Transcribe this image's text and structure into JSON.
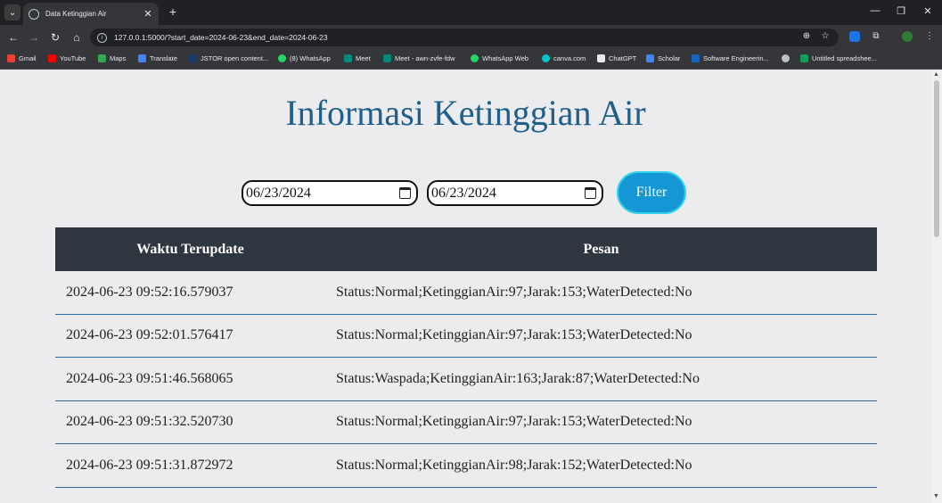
{
  "browser": {
    "tab_title": "Data Ketinggian Air",
    "url": "127.0.0.1:5000/?start_date=2024-06-23&end_date=2024-06-23",
    "bookmarks": [
      {
        "label": "Gmail",
        "color": "#ea4335"
      },
      {
        "label": "YouTube",
        "color": "#ff0000"
      },
      {
        "label": "Maps",
        "color": "#34a853"
      },
      {
        "label": "Translate",
        "color": "#4285f4"
      },
      {
        "label": "JSTOR open content...",
        "color": "#1a3c6b"
      },
      {
        "label": "(8) WhatsApp",
        "color": "#25d366"
      },
      {
        "label": "Meet",
        "color": "#00897b"
      },
      {
        "label": "Meet - awn-zvfe-fdw",
        "color": "#00897b"
      },
      {
        "label": "WhatsApp Web",
        "color": "#25d366"
      },
      {
        "label": "canva.com",
        "color": "#00c4cc"
      },
      {
        "label": "ChatGPT",
        "color": "#e8eaed"
      },
      {
        "label": "Scholar",
        "color": "#4285f4"
      },
      {
        "label": "Software Engineerin...",
        "color": "#1565c0"
      },
      {
        "label": "",
        "color": "#bdc1c6"
      },
      {
        "label": "Untitled spreadshee...",
        "color": "#0f9d58"
      }
    ]
  },
  "page": {
    "title": "Informasi Ketinggian Air",
    "start_date": "06/23/2024",
    "end_date": "06/23/2024",
    "filter_label": "Filter",
    "table": {
      "headers": [
        "Waktu Terupdate",
        "Pesan"
      ],
      "rows": [
        [
          "2024-06-23 09:52:16.579037",
          "Status:Normal;KetinggianAir:97;Jarak:153;WaterDetected:No"
        ],
        [
          "2024-06-23 09:52:01.576417",
          "Status:Normal;KetinggianAir:97;Jarak:153;WaterDetected:No"
        ],
        [
          "2024-06-23 09:51:46.568065",
          "Status:Waspada;KetinggianAir:163;Jarak:87;WaterDetected:No"
        ],
        [
          "2024-06-23 09:51:32.520730",
          "Status:Normal;KetinggianAir:97;Jarak:153;WaterDetected:No"
        ],
        [
          "2024-06-23 09:51:31.872972",
          "Status:Normal;KetinggianAir:98;Jarak:152;WaterDetected:No"
        ]
      ]
    }
  }
}
